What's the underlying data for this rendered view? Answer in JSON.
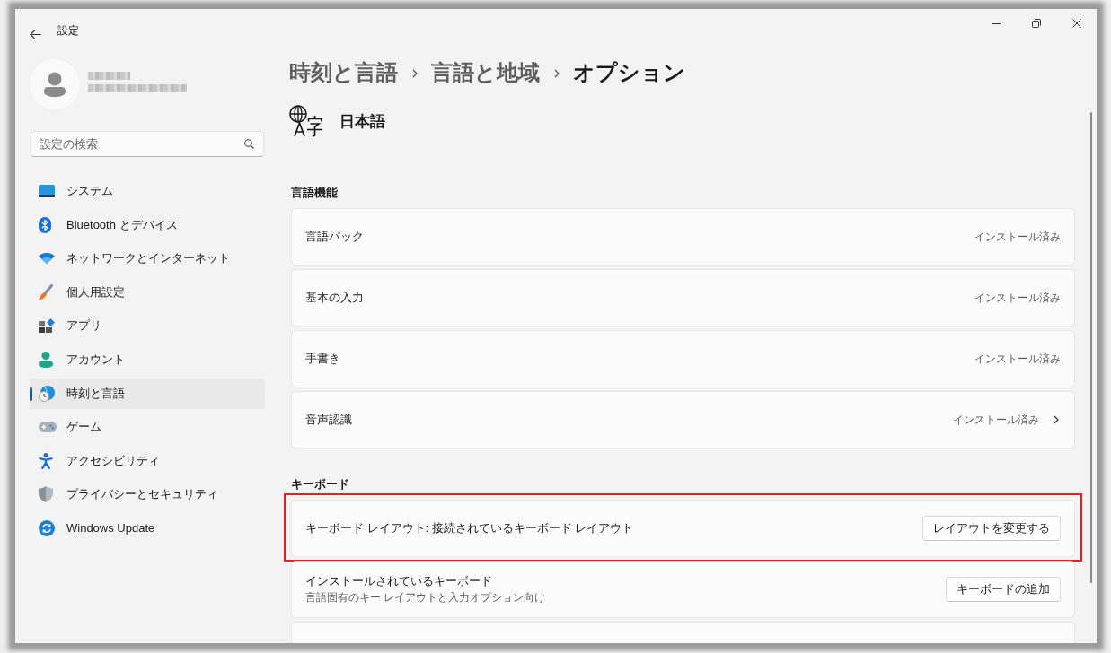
{
  "title_bar": {
    "title": "設定"
  },
  "search": {
    "placeholder": "設定の検索"
  },
  "sidebar": {
    "items": [
      {
        "label": "システム",
        "selected": false
      },
      {
        "label": "Bluetooth とデバイス",
        "selected": false
      },
      {
        "label": "ネットワークとインターネット",
        "selected": false
      },
      {
        "label": "個人用設定",
        "selected": false
      },
      {
        "label": "アプリ",
        "selected": false
      },
      {
        "label": "アカウント",
        "selected": false
      },
      {
        "label": "時刻と言語",
        "selected": true
      },
      {
        "label": "ゲーム",
        "selected": false
      },
      {
        "label": "アクセシビリティ",
        "selected": false
      },
      {
        "label": "プライバシーとセキュリティ",
        "selected": false
      },
      {
        "label": "Windows Update",
        "selected": false
      }
    ]
  },
  "breadcrumb": [
    {
      "label": "時刻と言語",
      "current": false
    },
    {
      "label": "言語と地域",
      "current": false
    },
    {
      "label": "オプション",
      "current": true
    }
  ],
  "language": {
    "name": "日本語"
  },
  "sections": [
    {
      "heading": "言語機能",
      "cards": [
        {
          "kind": "status",
          "label": "言語パック",
          "status": "インストール済み",
          "chevron": false,
          "highlighted": false
        },
        {
          "kind": "status",
          "label": "基本の入力",
          "status": "インストール済み",
          "chevron": false,
          "highlighted": false
        },
        {
          "kind": "status",
          "label": "手書き",
          "status": "インストール済み",
          "chevron": false,
          "highlighted": false
        },
        {
          "kind": "status",
          "label": "音声認識",
          "status": "インストール済み",
          "chevron": true,
          "highlighted": false
        }
      ]
    },
    {
      "heading": "キーボード",
      "cards": [
        {
          "kind": "action",
          "label": "キーボード レイアウト: 接続されているキーボード レイアウト",
          "button": "レイアウトを変更する",
          "highlighted": true
        },
        {
          "kind": "action",
          "label": "インストールされているキーボード",
          "description": "言語固有のキー レイアウトと入力オプション向け",
          "button": "キーボードの追加",
          "highlighted": false
        },
        {
          "kind": "cut_off",
          "highlighted": false
        }
      ]
    }
  ]
}
